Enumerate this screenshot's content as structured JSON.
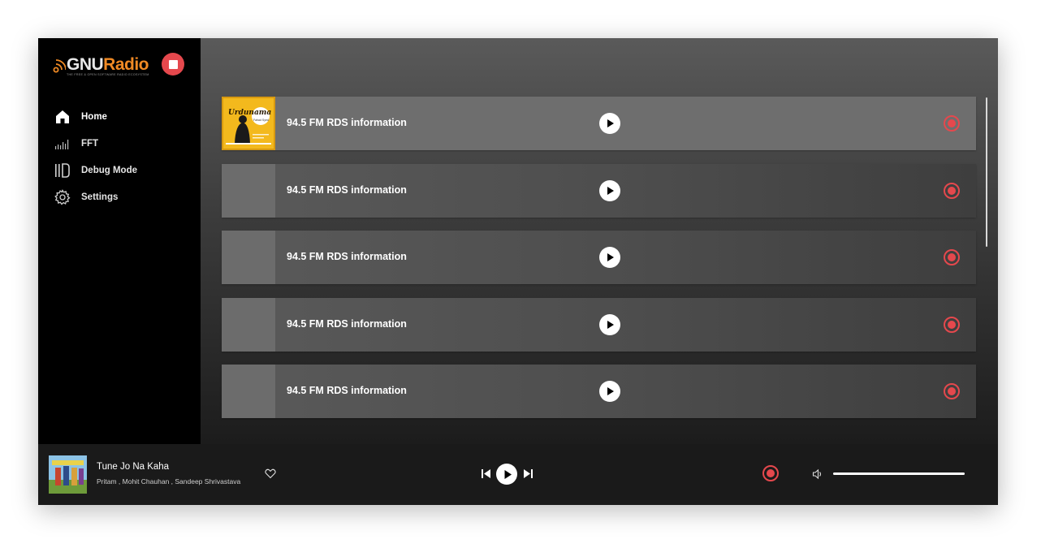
{
  "app": {
    "logo_gnu": "GNU",
    "logo_radio": "Radio",
    "logo_tagline": "The Free & Open Software Radio Ecosystem"
  },
  "sidebar": {
    "items": [
      {
        "label": "Home",
        "icon": "home-icon",
        "active": true
      },
      {
        "label": "FFT",
        "icon": "signal-bars-icon",
        "active": false
      },
      {
        "label": "Debug Mode",
        "icon": "debug-icon",
        "active": false
      },
      {
        "label": "Settings",
        "icon": "gear-icon",
        "active": false
      }
    ]
  },
  "stations": [
    {
      "title": "94.5 FM RDS information",
      "has_art": true,
      "art_text": "Urdunama",
      "art_subtext": "Fahad Syed"
    },
    {
      "title": "94.5 FM RDS information",
      "has_art": false
    },
    {
      "title": "94.5 FM RDS information",
      "has_art": false
    },
    {
      "title": "94.5 FM RDS information",
      "has_art": false
    },
    {
      "title": "94.5 FM RDS information",
      "has_art": false
    }
  ],
  "player": {
    "song": "Tune Jo Na Kaha",
    "artists": "Pritam , Mohit Chauhan  , Sandeep Shrivastava",
    "volume": 1.0
  },
  "colors": {
    "accent": "#e5484d",
    "logo_orange": "#f08a24",
    "art_yellow": "#f3b91d"
  }
}
